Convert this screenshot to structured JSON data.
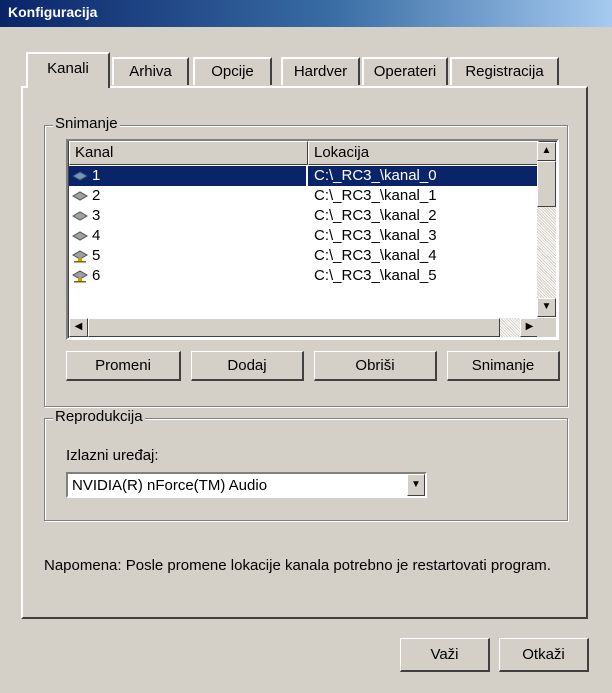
{
  "window": {
    "title": "Konfiguracija"
  },
  "tabs": [
    {
      "label": "Kanali",
      "active": true
    },
    {
      "label": "Arhiva",
      "active": false
    },
    {
      "label": "Opcije",
      "active": false
    },
    {
      "label": "Hardver",
      "active": false
    },
    {
      "label": "Operateri",
      "active": false
    },
    {
      "label": "Registracija",
      "active": false
    }
  ],
  "snimanje": {
    "group_label": "Snimanje",
    "columns": [
      "Kanal",
      "Lokacija"
    ],
    "rows": [
      {
        "kanal": "1",
        "lokacija": "C:\\_RC3_\\kanal_0",
        "icon": "drive-icon",
        "selected": true
      },
      {
        "kanal": "2",
        "lokacija": "C:\\_RC3_\\kanal_1",
        "icon": "drive-icon",
        "selected": false
      },
      {
        "kanal": "3",
        "lokacija": "C:\\_RC3_\\kanal_2",
        "icon": "drive-icon",
        "selected": false
      },
      {
        "kanal": "4",
        "lokacija": "C:\\_RC3_\\kanal_3",
        "icon": "drive-icon",
        "selected": false
      },
      {
        "kanal": "5",
        "lokacija": "C:\\_RC3_\\kanal_4",
        "icon": "network-drive-icon",
        "selected": false
      },
      {
        "kanal": "6",
        "lokacija": "C:\\_RC3_\\kanal_5",
        "icon": "network-drive-icon",
        "selected": false
      }
    ],
    "buttons": {
      "promeni": "Promeni",
      "dodaj": "Dodaj",
      "obrisi": "Obriši",
      "snimanje": "Snimanje"
    }
  },
  "reprodukcija": {
    "group_label": "Reprodukcija",
    "output_label": "Izlazni uređaj:",
    "output_value": "NVIDIA(R) nForce(TM) Audio"
  },
  "note": "Napomena: Posle promene lokacije kanala potrebno je restartovati program.",
  "footer": {
    "ok": "Važi",
    "cancel": "Otkaži"
  },
  "colors": {
    "selection": "#0a246a",
    "title_start": "#0a246a",
    "title_end": "#a6caf0",
    "face": "#d4d0c8"
  }
}
